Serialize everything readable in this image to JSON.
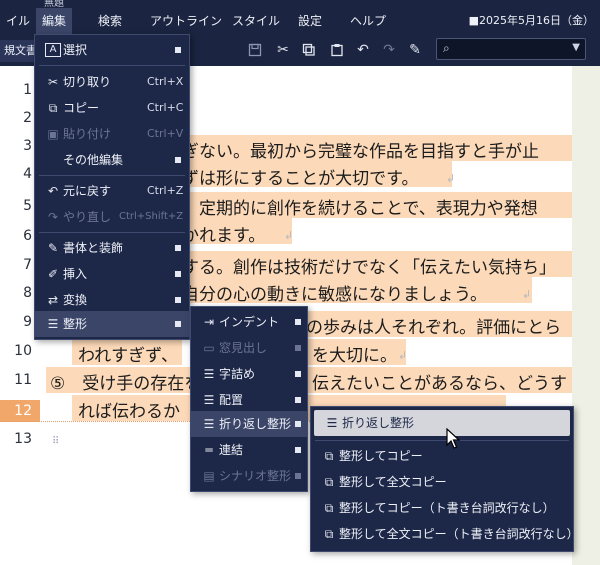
{
  "window": {
    "partial_title": "無題"
  },
  "menubar": {
    "items": [
      "イル",
      "編集",
      "検索",
      "アウトライン",
      "スタイル",
      "設定",
      "ヘルプ"
    ],
    "date": "■2025年5月16日（金）"
  },
  "toolbar": {
    "doc_tab": "規文書",
    "icons": [
      "save-icon",
      "cut-icon",
      "copy-icon",
      "paste-icon",
      "undo-icon",
      "redo-icon",
      "format-brush-icon"
    ],
    "search_placeholder": ""
  },
  "editor": {
    "line_numbers": [
      "1",
      "2",
      "3",
      "4",
      "5",
      "6",
      "7",
      "8",
      "9",
      "10",
      "11",
      "12",
      "13"
    ],
    "current_line": "12",
    "lines": [
      {
        "n": "3",
        "text": "ぎない。最初から完璧な作品を目指すと手が止"
      },
      {
        "n": "4",
        "text": "ずは形にすることが大切です。"
      },
      {
        "n": "5",
        "text": "。定期的に創作を続けることで、表現力や発想"
      },
      {
        "n": "6",
        "text": "かれます。"
      },
      {
        "n": "7",
        "text": "する。創作は技術だけでなく「伝えたい気持ち」"
      },
      {
        "n": "8",
        "text": "自分の心の動きに敏感になりましょう。"
      },
      {
        "n": "9",
        "text": "の歩みは人それぞれ。評価にとら"
      },
      {
        "n": "10a",
        "text": "われすぎず、"
      },
      {
        "n": "10b",
        "text": "を大切に。"
      },
      {
        "n": "11a",
        "text": "⑤　受け手の存在を"
      },
      {
        "n": "11b",
        "text": "伝えたいことがあるなら、どうす"
      },
      {
        "n": "12",
        "text": "れば伝わるか"
      }
    ],
    "paragraph_mark": "↲"
  },
  "edit_menu": {
    "items": [
      {
        "icon": "select-icon",
        "glyph": "A",
        "label": "選択",
        "shortcut": "",
        "submenu": true,
        "disabled": false
      },
      {
        "icon": "cut-icon",
        "glyph": "✂",
        "label": "切り取り",
        "shortcut": "Ctrl+X",
        "submenu": false,
        "disabled": false
      },
      {
        "icon": "copy-icon",
        "glyph": "⧉",
        "label": "コピー",
        "shortcut": "Ctrl+C",
        "submenu": false,
        "disabled": false
      },
      {
        "icon": "paste-icon",
        "glyph": "📋",
        "label": "貼り付け",
        "shortcut": "Ctrl+V",
        "submenu": false,
        "disabled": true
      },
      {
        "icon": "",
        "glyph": "",
        "label": "その他編集",
        "shortcut": "",
        "submenu": true,
        "disabled": false
      },
      {
        "icon": "undo-icon",
        "glyph": "↶",
        "label": "元に戻す",
        "shortcut": "Ctrl+Z",
        "submenu": false,
        "disabled": false
      },
      {
        "icon": "redo-icon",
        "glyph": "↷",
        "label": "やり直し",
        "shortcut": "Ctrl+Shift+Z",
        "submenu": false,
        "disabled": true
      },
      {
        "icon": "typeface-icon",
        "glyph": "✎",
        "label": "書体と装飾",
        "shortcut": "",
        "submenu": true,
        "disabled": false
      },
      {
        "icon": "insert-icon",
        "glyph": "✐",
        "label": "挿入",
        "shortcut": "",
        "submenu": true,
        "disabled": false
      },
      {
        "icon": "convert-icon",
        "glyph": "⇄",
        "label": "変換",
        "shortcut": "",
        "submenu": true,
        "disabled": false
      },
      {
        "icon": "format-icon",
        "glyph": "☰",
        "label": "整形",
        "shortcut": "",
        "submenu": true,
        "disabled": false
      }
    ]
  },
  "format_menu": {
    "items": [
      {
        "icon": "indent-icon",
        "glyph": "⇥",
        "label": "インデント",
        "disabled": false
      },
      {
        "icon": "heading-icon",
        "glyph": "▭",
        "label": "窓見出し",
        "disabled": true
      },
      {
        "icon": "compact-icon",
        "glyph": "☰",
        "label": "字詰め",
        "disabled": false
      },
      {
        "icon": "align-icon",
        "glyph": "☰",
        "label": "配置",
        "disabled": false
      },
      {
        "icon": "wrap-icon",
        "glyph": "☰",
        "label": "折り返し整形",
        "disabled": false
      },
      {
        "icon": "join-icon",
        "glyph": "═",
        "label": "連結",
        "disabled": false
      },
      {
        "icon": "scenario-icon",
        "glyph": "▤",
        "label": "シナリオ整形",
        "disabled": true
      }
    ]
  },
  "wrap_menu": {
    "items": [
      {
        "icon": "wrap-format-icon",
        "glyph": "☰",
        "label": "折り返し整形"
      },
      {
        "icon": "format-copy-icon",
        "glyph": "⧉",
        "label": "整形してコピー"
      },
      {
        "icon": "format-copy-all-icon",
        "glyph": "⧉",
        "label": "整形して全文コピー"
      },
      {
        "icon": "format-copy-noline-icon",
        "glyph": "⧉",
        "label": "整形してコピー（ト書き台詞改行なし）"
      },
      {
        "icon": "format-copy-all-noline-icon",
        "glyph": "⧉",
        "label": "整形して全文コピー（ト書き台詞改行なし）"
      }
    ]
  }
}
